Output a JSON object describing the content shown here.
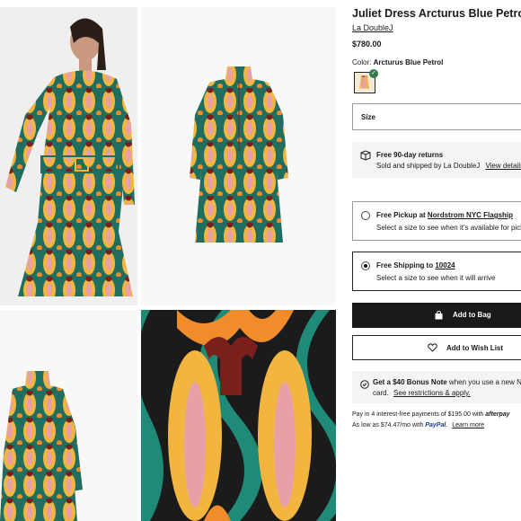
{
  "product": {
    "title": "Juliet Dress Arcturus Blue Petrol",
    "brand": "La DoubleJ",
    "price": "$780.00",
    "color_label": "Color:",
    "color_value": "Arcturus Blue Petrol",
    "size_label": "Size"
  },
  "returns": {
    "title": "Free 90-day returns",
    "sold_by": "Sold and shipped by La DoubleJ",
    "view_details": "View details",
    "icon": "box-return-icon"
  },
  "fulfillment": {
    "pickup": {
      "label_prefix": "Free Pickup at",
      "store": "Nordstrom NYC Flagship",
      "hint": "Select a size to see when it's available for pickup",
      "selected": false
    },
    "shipping": {
      "label_prefix": "Free Shipping to",
      "zip": "10024",
      "hint": "Select a size to see when it will arrive",
      "selected": true
    }
  },
  "actions": {
    "add_to_bag": "Add to Bag",
    "add_to_wishlist": "Add to Wish List"
  },
  "bonus": {
    "bold": "Get a $40 Bonus Note",
    "rest": "when you use a new Nordstrom",
    "line2": "card.",
    "link": "See restrictions & apply."
  },
  "payments": {
    "line1": "Pay in 4 interest-free payments of $195.00 with",
    "afterpay": "afterpay",
    "line2": "As low as $74.47/mo with",
    "paypal": "PayPal",
    "learn_more": "Learn more"
  },
  "colors": {
    "accent_dark": "#1a1a1a",
    "pattern_green": "#1f7c6a",
    "pattern_yellow": "#f2b640",
    "pattern_pink": "#e8a0a8",
    "pattern_maroon": "#7a1f1c"
  },
  "gallery": {
    "images": [
      "model-front-photo",
      "dress-front-photo",
      "dress-side-photo",
      "fabric-closeup-photo"
    ]
  }
}
